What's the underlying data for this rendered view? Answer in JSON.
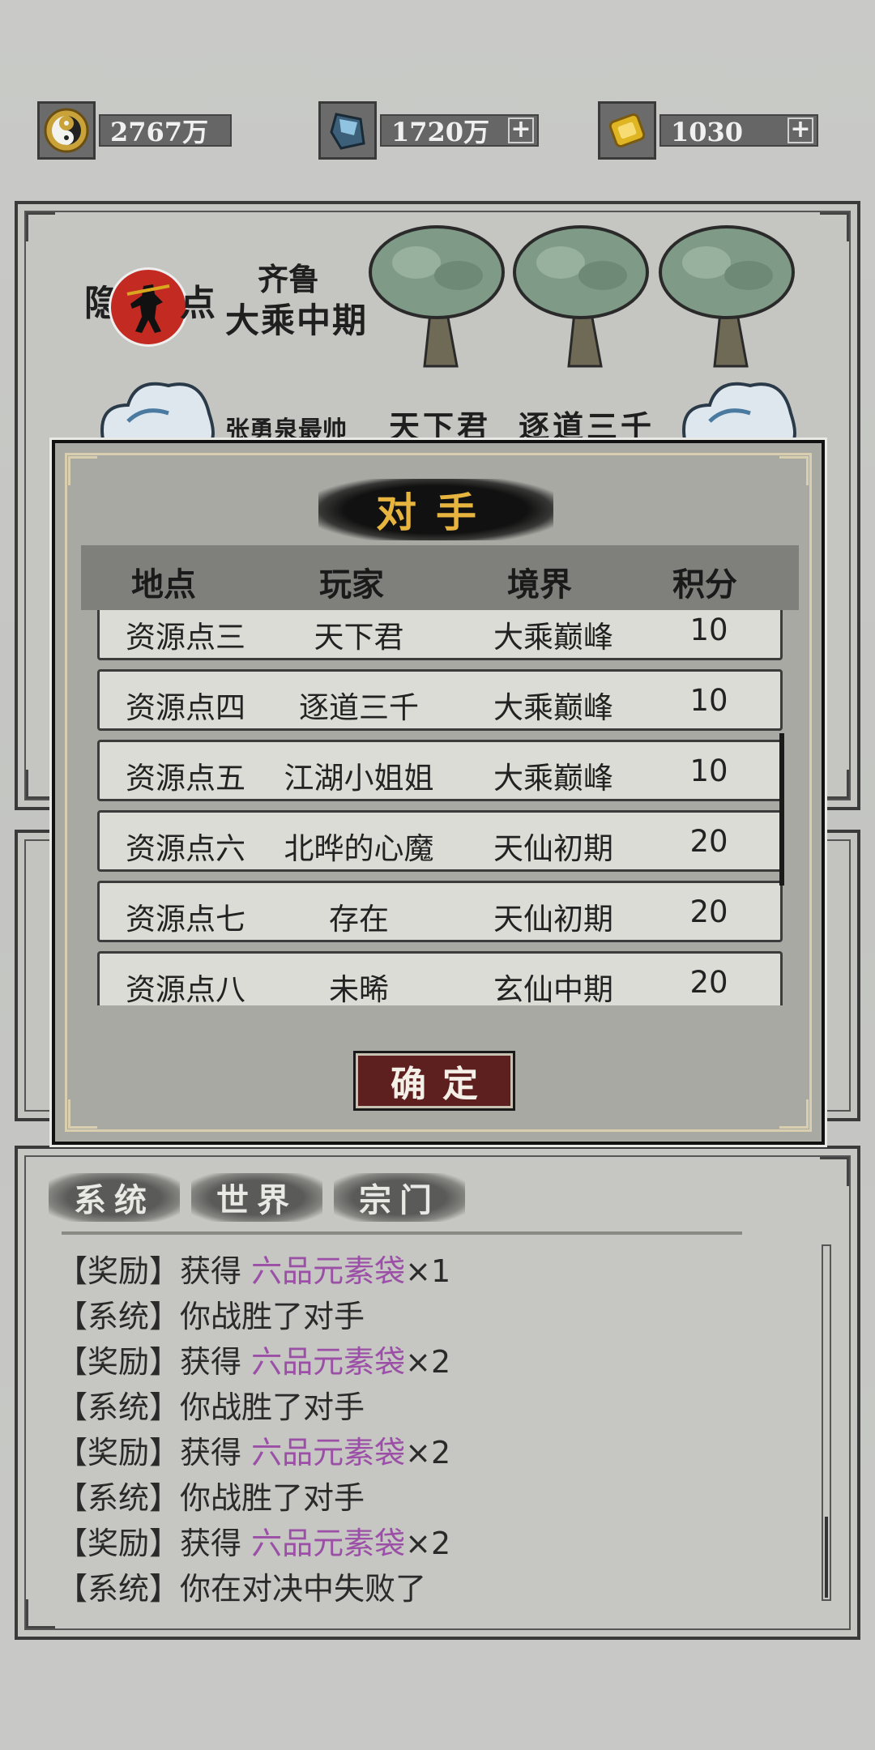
{
  "currencies": [
    {
      "icon": "taiji-coin-icon",
      "value": "2767万",
      "plus": ""
    },
    {
      "icon": "spirit-crystal-icon",
      "value": "1720万",
      "plus": "+"
    },
    {
      "icon": "gold-ingot-icon",
      "value": "1030",
      "plus": "+"
    }
  ],
  "sect_panel": {
    "emblem_label_left": "隐",
    "emblem_label_right": "点",
    "owner_name": "齐鲁",
    "owner_realm": "大乘中期",
    "guardians": [
      "张勇泉最帅",
      "天下君",
      "逐道三千"
    ]
  },
  "dialog": {
    "title": "对手",
    "columns": [
      "地点",
      "玩家",
      "境界",
      "积分"
    ],
    "rows": [
      {
        "place": "资源点三",
        "player": "天下君",
        "realm": "大乘巅峰",
        "score": "10"
      },
      {
        "place": "资源点四",
        "player": "逐道三千",
        "realm": "大乘巅峰",
        "score": "10"
      },
      {
        "place": "资源点五",
        "player": "江湖小姐姐",
        "realm": "大乘巅峰",
        "score": "10"
      },
      {
        "place": "资源点六",
        "player": "北晔的心魔",
        "realm": "天仙初期",
        "score": "20"
      },
      {
        "place": "资源点七",
        "player": "存在",
        "realm": "天仙初期",
        "score": "20"
      },
      {
        "place": "资源点八",
        "player": "未晞",
        "realm": "玄仙中期",
        "score": "20"
      }
    ],
    "confirm": "确定"
  },
  "chat": {
    "tabs": [
      "系统",
      "世界",
      "宗门"
    ],
    "lines": [
      {
        "tag": "【奖励】",
        "text": "获得 ",
        "item": "六品元素袋",
        "count": "×1"
      },
      {
        "tag": "【系统】",
        "text": "你战胜了对手",
        "item": "",
        "count": ""
      },
      {
        "tag": "【奖励】",
        "text": "获得 ",
        "item": "六品元素袋",
        "count": "×2"
      },
      {
        "tag": "【系统】",
        "text": "你战胜了对手",
        "item": "",
        "count": ""
      },
      {
        "tag": "【奖励】",
        "text": "获得 ",
        "item": "六品元素袋",
        "count": "×2"
      },
      {
        "tag": "【系统】",
        "text": "你战胜了对手",
        "item": "",
        "count": ""
      },
      {
        "tag": "【奖励】",
        "text": "获得 ",
        "item": "六品元素袋",
        "count": "×2"
      },
      {
        "tag": "【系统】",
        "text": "你在对决中失败了",
        "item": "",
        "count": ""
      }
    ]
  },
  "colors": {
    "item_purple": "#9b4fa6",
    "title_gold": "#e6b43f",
    "confirm_red": "#5e1f1f"
  }
}
